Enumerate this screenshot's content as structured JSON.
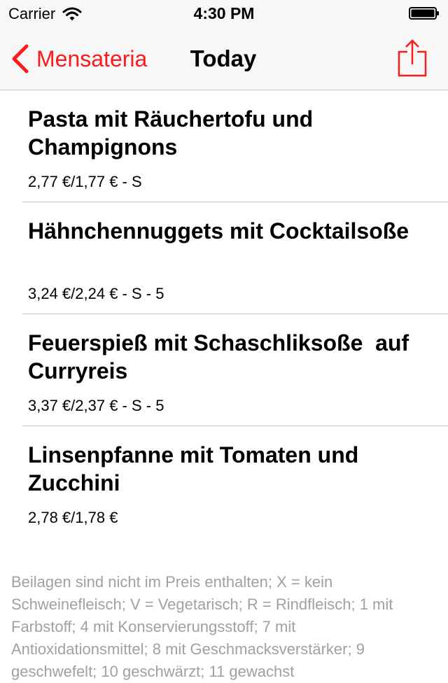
{
  "status_bar": {
    "carrier": "Carrier",
    "time": "4:30 PM"
  },
  "nav": {
    "back_label": "Mensateria",
    "title": "Today",
    "accent_color": "#ff1a1a"
  },
  "meals": [
    {
      "title": "Pasta mit Räuchertofu und Champignons",
      "price": "2,77 €/1,77 € - S"
    },
    {
      "title": "Hähnchennuggets mit Cocktailsoße",
      "price": "3,24 €/2,24 € - S - 5"
    },
    {
      "title": "Feuerspieß mit Schaschliksoße  auf Curryreis",
      "price": "3,37 €/2,37 € - S - 5"
    },
    {
      "title": "Linsenpfanne mit Tomaten und Zucchini",
      "price": "2,78 €/1,78 €"
    }
  ],
  "footer": "Beilagen sind nicht im Preis enthalten; X = kein Schweinefleisch; V = Vegetarisch; R = Rindfleisch; 1 mit Farbstoff; 4 mit Konservierungsstoff; 7 mit Antioxidationsmittel; 8 mit Geschmacksverstärker; 9 geschwefelt; 10 geschwärzt; 11 gewachst"
}
